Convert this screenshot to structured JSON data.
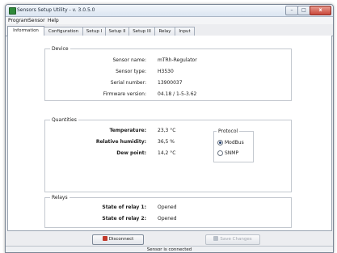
{
  "window": {
    "title": "Sensors Setup Utility - v. 3.0.5.0",
    "min_label": "–",
    "max_label": "□",
    "close_label": "x"
  },
  "menu": {
    "items": [
      {
        "label": "Program"
      },
      {
        "label": "Sensor"
      },
      {
        "label": "Help"
      }
    ]
  },
  "tabs": [
    {
      "label": "Information",
      "active": true
    },
    {
      "label": "Configuration"
    },
    {
      "label": "Setup I"
    },
    {
      "label": "Setup II"
    },
    {
      "label": "Setup III"
    },
    {
      "label": "Relay"
    },
    {
      "label": "Input"
    }
  ],
  "device": {
    "group_label": "Device",
    "rows": [
      {
        "label": "Sensor name:",
        "value": "mTRh-Regulator"
      },
      {
        "label": "Sensor type:",
        "value": "H3530"
      },
      {
        "label": "Serial number:",
        "value": "13900037"
      },
      {
        "label": "Firmware version:",
        "value": "04.18 / 1-5-3.62"
      }
    ]
  },
  "quantities": {
    "group_label": "Quantities",
    "rows": [
      {
        "label": "Temperature:",
        "value": "23,3 °C"
      },
      {
        "label": "Relative humidity:",
        "value": "36,5 %"
      },
      {
        "label": "Dew point:",
        "value": "14,2 °C"
      }
    ]
  },
  "protocol": {
    "group_label": "Protocol",
    "options": [
      {
        "label": "ModBus",
        "selected": true
      },
      {
        "label": "SNMP",
        "selected": false
      }
    ]
  },
  "relays": {
    "group_label": "Relays",
    "rows": [
      {
        "label": "State of relay 1:",
        "value": "Opened"
      },
      {
        "label": "State of relay 2:",
        "value": "Opened"
      }
    ]
  },
  "footer": {
    "disconnect_label": "Disconnect",
    "save_label": "Save Changes",
    "status_text": "Sensor is connected"
  },
  "colors": {
    "disconnect_icon": "#c23a2c",
    "save_icon": "#b9c0c9"
  }
}
